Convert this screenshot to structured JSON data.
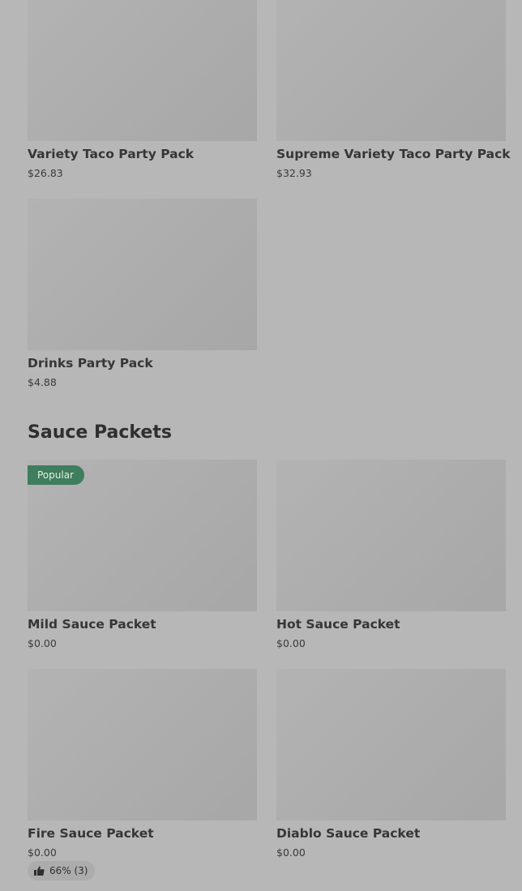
{
  "party_items": [
    {
      "name": "Variety Taco Party Pack",
      "price": "$26.83"
    },
    {
      "name": "Supreme Variety Taco Party Pack",
      "price": "$32.93"
    },
    {
      "name": "Drinks Party Pack",
      "price": "$4.88"
    }
  ],
  "sauce_section": {
    "title": "Sauce Packets",
    "items": [
      {
        "name": "Mild Sauce Packet",
        "price": "$0.00",
        "badge": "Popular"
      },
      {
        "name": "Hot Sauce Packet",
        "price": "$0.00"
      },
      {
        "name": "Fire Sauce Packet",
        "price": "$0.00",
        "rating": "66% (3)",
        "rating_icon": "thumbs-up-icon"
      },
      {
        "name": "Diablo Sauce Packet",
        "price": "$0.00"
      }
    ]
  },
  "colors": {
    "background": "#b7b7b7",
    "image_placeholder": "#aaaaaa",
    "badge": "#3e7d5d"
  }
}
